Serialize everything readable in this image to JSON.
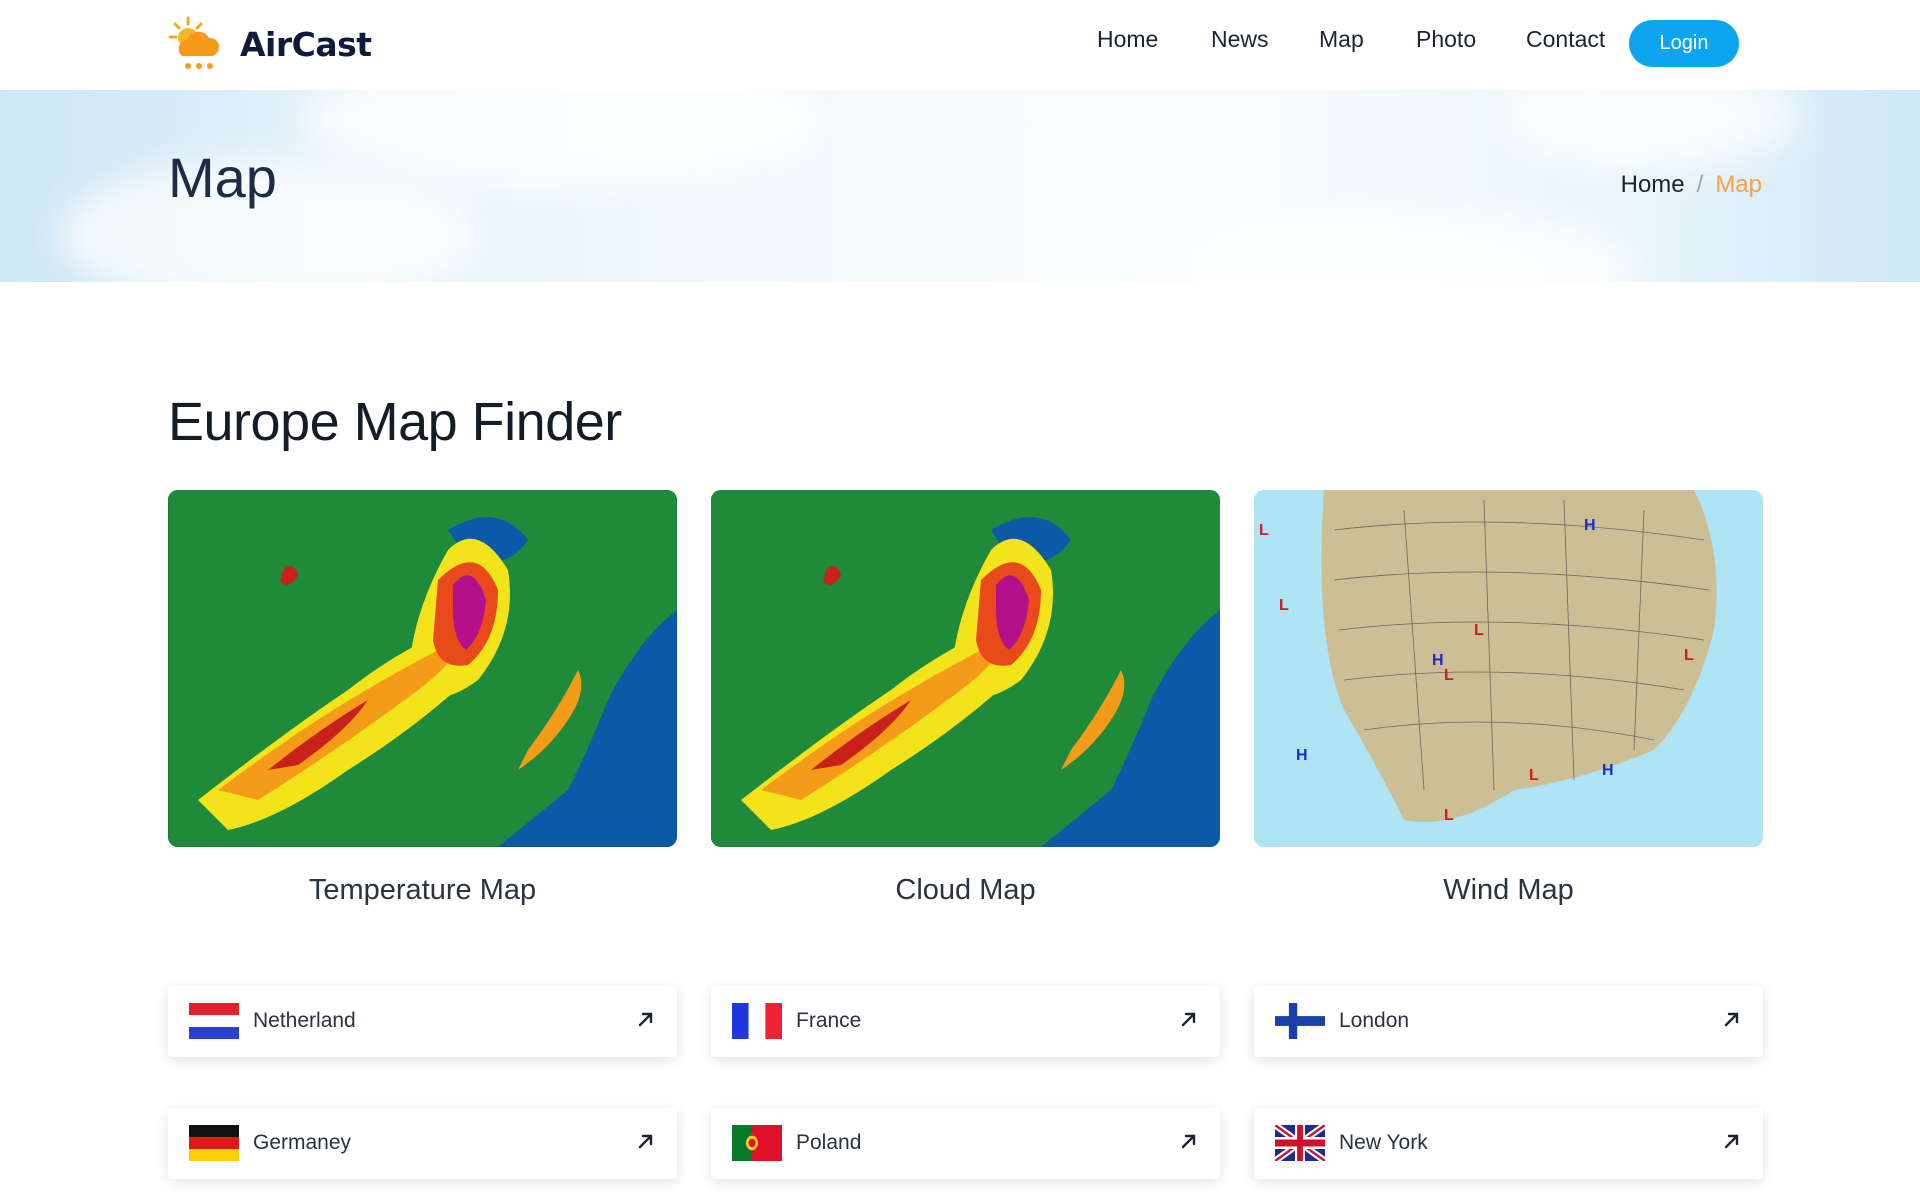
{
  "brand": {
    "name": "AirCast",
    "logo_icon": "sun-cloud-rain-icon"
  },
  "nav": {
    "items": [
      {
        "label": "Home"
      },
      {
        "label": "News"
      },
      {
        "label": "Map"
      },
      {
        "label": "Photo"
      },
      {
        "label": "Contact"
      }
    ],
    "login_label": "Login"
  },
  "hero": {
    "title": "Map",
    "breadcrumb": {
      "home": "Home",
      "separator": "/",
      "current": "Map"
    }
  },
  "section": {
    "title": "Europe Map Finder",
    "maps": [
      {
        "caption": "Temperature Map",
        "image": "temperature-radar-map"
      },
      {
        "caption": "Cloud Map",
        "image": "cloud-radar-map"
      },
      {
        "caption": "Wind Map",
        "image": "wind-pressure-map"
      }
    ],
    "countries": [
      {
        "name": "Netherland",
        "flag": "netherlands-flag"
      },
      {
        "name": "France",
        "flag": "france-flag"
      },
      {
        "name": "London",
        "flag": "finland-flag"
      },
      {
        "name": "Germaney",
        "flag": "germany-flag"
      },
      {
        "name": "Poland",
        "flag": "portugal-flag"
      },
      {
        "name": "New York",
        "flag": "uk-flag"
      }
    ]
  },
  "colors": {
    "accent": "#0ea5f0",
    "breadcrumb_current": "#f5a04a",
    "logo_orange": "#f59e0b"
  }
}
